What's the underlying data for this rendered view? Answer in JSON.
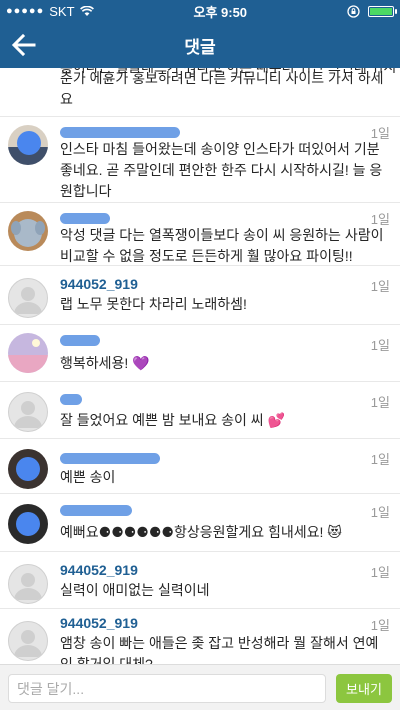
{
  "status_bar": {
    "carrier": "SKT",
    "time": "오후 9:50"
  },
  "header": {
    "title": "댓글"
  },
  "feed": {
    "top_fragment_clipped": "홍이라는 멜들레트가 뭐라고 이른 때부터 쉬잔 그런데 위시",
    "top_fragment": "춘가 에휸가 홍보하려면 다른 커뮤니티 사이트 가서 하세요",
    "comments": [
      {
        "username": "",
        "time": "1일",
        "text": "인스타 마침 들어왔는데 송이양 인스타가 떠있어서 기분좋네요. 곧 주말인데 편안한 한주 다시 시작하시길! 늘 응원합니다"
      },
      {
        "username": "",
        "time": "1일",
        "text": "악성 댓글 다는 열폭쟁이들보다 송이 씨 응원하는 사람이 비교할 수 없을 정도로 든든하게 훨 많아요 파이팅!!"
      },
      {
        "username": "944052_919",
        "time": "1일",
        "text": "랩 노무 못한다 차라리 노래하셈!"
      },
      {
        "username": "",
        "time": "1일",
        "text": "행복하세용! 💜"
      },
      {
        "username": "",
        "time": "1일",
        "text": "잘 들었어요 예쁜 밤 보내요 송이 씨 💕"
      },
      {
        "username": "",
        "time": "1일",
        "text": "예쁜 송이"
      },
      {
        "username": "",
        "time": "1일",
        "text": "예뻐요⚈⚈⚈⚈⚈⚈항상응원할게요 힘내세요! 😻"
      },
      {
        "username": "944052_919",
        "time": "1일",
        "text": "실력이 애미없는 실력이네"
      },
      {
        "username": "944052_919",
        "time": "1일",
        "text": "앰창 송이 빠는 애들은 좆 잡고 반성해라 뭘 잘해서 연예인 할거임 대체?"
      }
    ]
  },
  "comment_input": {
    "placeholder": "댓글 달기...",
    "send_label": "보내기"
  },
  "colors": {
    "header_bg": "#1f5f93",
    "username": "#1f5f93",
    "send_button": "#8cc63f",
    "redaction": "#6fa0e6"
  }
}
